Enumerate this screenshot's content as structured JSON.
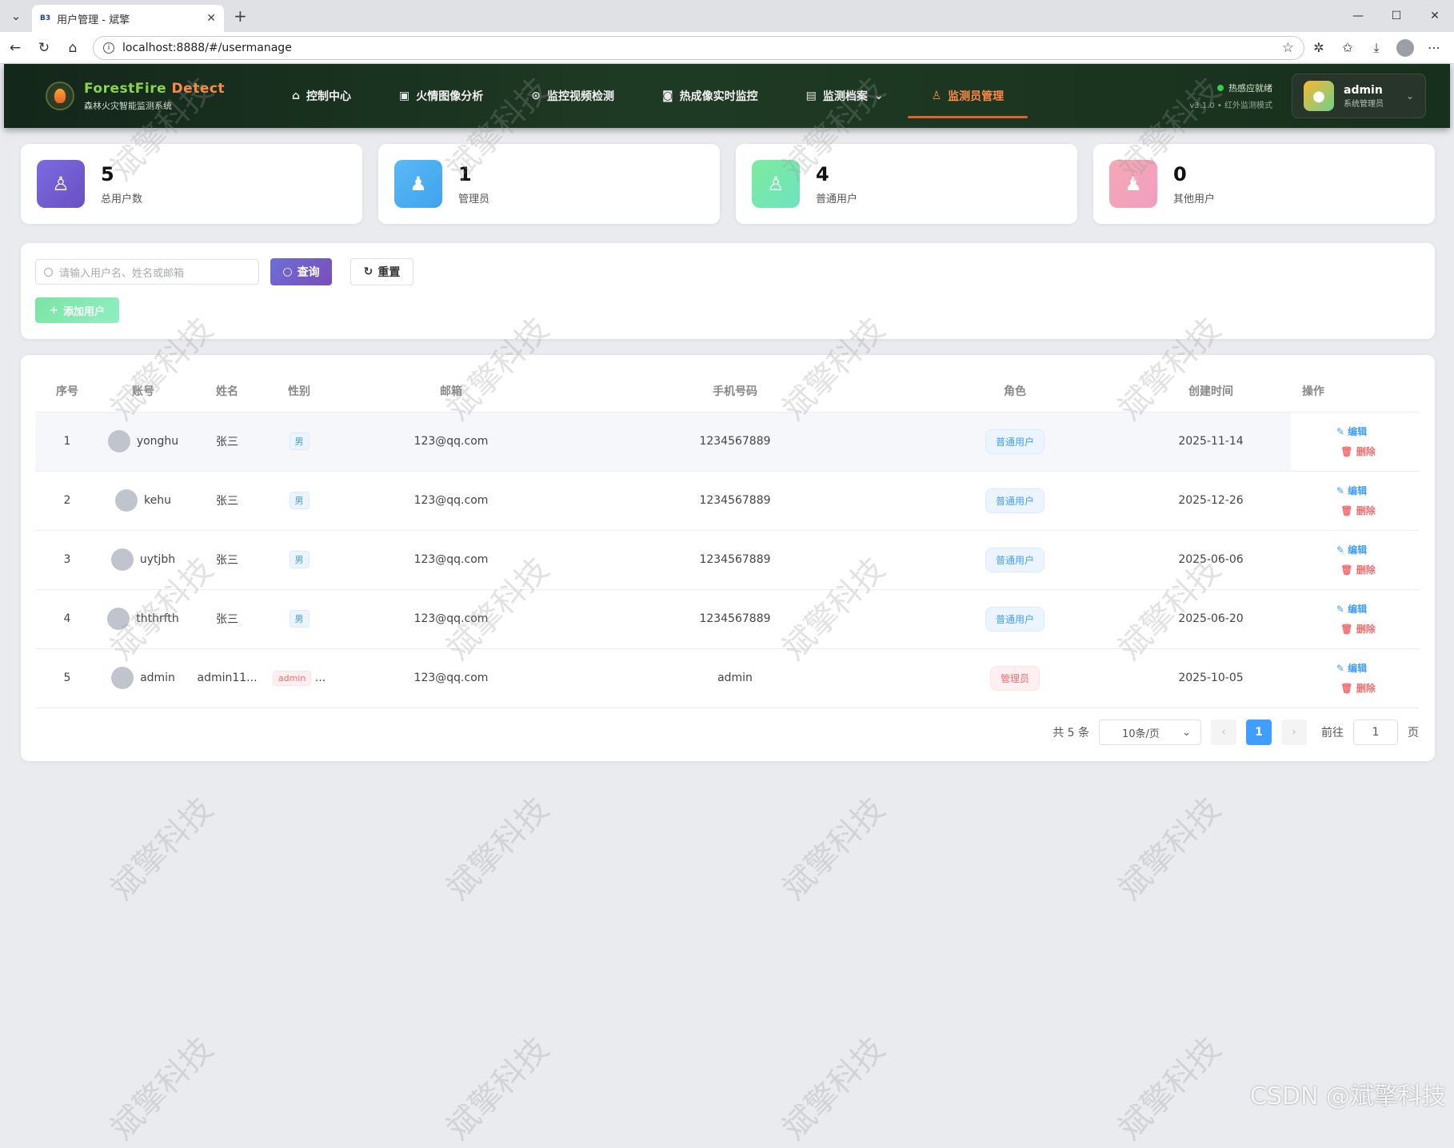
{
  "browser": {
    "tab_title": "用户管理 - 斌擎",
    "tab_favicon": "B3",
    "url": "localhost:8888/#/usermanage"
  },
  "header": {
    "brand_a": "ForestFire",
    "brand_b": "Detect",
    "subtitle": "森林火灾智能监测系统",
    "nav": [
      {
        "label": "控制中心",
        "icon": "home-icon"
      },
      {
        "label": "火情图像分析",
        "icon": "image-icon"
      },
      {
        "label": "监控视频检测",
        "icon": "play-icon"
      },
      {
        "label": "热成像实时监控",
        "icon": "camera-icon"
      },
      {
        "label": "监测档案",
        "icon": "document-icon"
      },
      {
        "label": "监测员管理",
        "icon": "user-icon"
      }
    ],
    "status_line1": "热感应就绪",
    "status_line2": "v3.1.0 • 红外监测模式",
    "user_name": "admin",
    "user_role": "系统管理员"
  },
  "stats": [
    {
      "value": "5",
      "label": "总用户数",
      "color": "#6a5acd"
    },
    {
      "value": "1",
      "label": "管理员",
      "color": "#4fb3f0"
    },
    {
      "value": "4",
      "label": "普通用户",
      "color": "#6ee7a6"
    },
    {
      "value": "0",
      "label": "其他用户",
      "color": "#f3a0b3"
    }
  ],
  "filter": {
    "search_placeholder": "请输入用户名、姓名或邮箱",
    "query_label": "查询",
    "reset_label": "重置",
    "add_label": "添加用户"
  },
  "table": {
    "headers": [
      "序号",
      "账号",
      "姓名",
      "性别",
      "邮箱",
      "手机号码",
      "角色",
      "创建时间",
      "操作"
    ],
    "rows": [
      {
        "no": "1",
        "account": "yonghu",
        "name": "张三",
        "gender": "男",
        "email": "123@qq.com",
        "phone": "1234567889",
        "role": "普通用户",
        "created": "2025-11-14"
      },
      {
        "no": "2",
        "account": "kehu",
        "name": "张三",
        "gender": "男",
        "email": "123@qq.com",
        "phone": "1234567889",
        "role": "普通用户",
        "created": "2025-12-26"
      },
      {
        "no": "3",
        "account": "uytjbh",
        "name": "张三",
        "gender": "男",
        "email": "123@qq.com",
        "phone": "1234567889",
        "role": "普通用户",
        "created": "2025-06-06"
      },
      {
        "no": "4",
        "account": "ththrfth",
        "name": "张三",
        "gender": "男",
        "email": "123@qq.com",
        "phone": "1234567889",
        "role": "普通用户",
        "created": "2025-06-20"
      },
      {
        "no": "5",
        "account": "admin",
        "name": "admin11...",
        "gender": "admin",
        "gender_more": "...",
        "email": "123@qq.com",
        "phone": "admin",
        "role": "管理员",
        "created": "2025-10-05"
      }
    ],
    "edit_label": "编辑",
    "delete_label": "删除"
  },
  "pager": {
    "total": "共 5 条",
    "size": "10条/页",
    "current": "1",
    "goto_label": "前往",
    "goto_value": "1",
    "page_suffix": "页"
  },
  "watermark": "斌擎科技",
  "csdn": "CSDN @斌擎科技"
}
